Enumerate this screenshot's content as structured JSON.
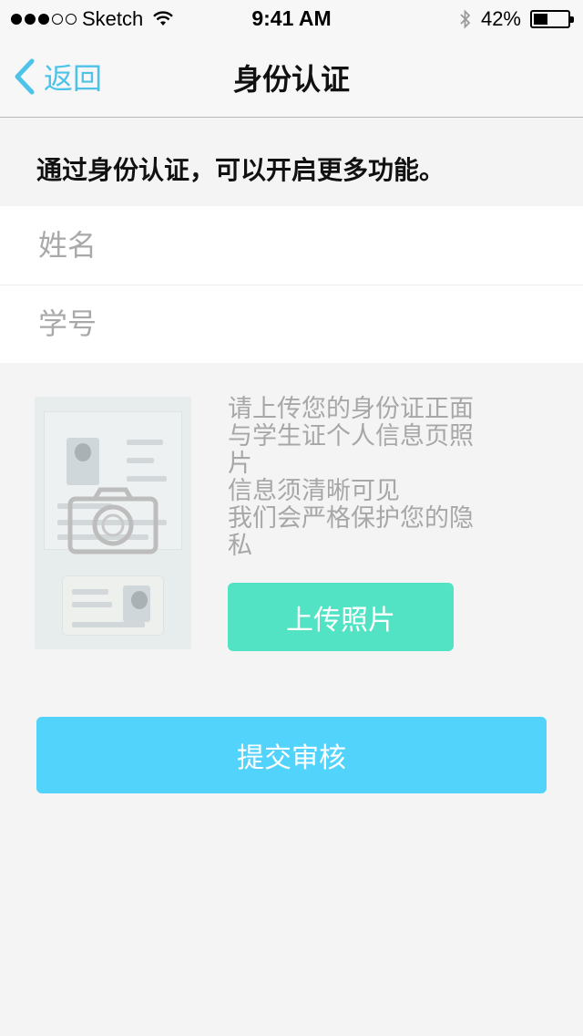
{
  "status_bar": {
    "carrier": "Sketch",
    "time": "9:41 AM",
    "battery_percent": "42%",
    "battery_level": 0.42,
    "signal_icon": "signal-dots-icon",
    "wifi_icon": "wifi-icon",
    "bluetooth_icon": "bluetooth-icon",
    "battery_icon": "battery-icon"
  },
  "nav": {
    "back_label": "返回",
    "back_icon": "chevron-left-icon",
    "title": "身份认证",
    "accent": "#4ec3ea"
  },
  "intro": "通过身份认证，可以开启更多功能。",
  "form": {
    "name_placeholder": "姓名",
    "student_id_placeholder": "学号"
  },
  "photo": {
    "camera_icon": "camera-icon",
    "hint_lines": [
      "请上传您的身份证正面",
      "与学生证个人信息页照",
      "片",
      "信息须清晰可见",
      "我们会严格保护您的隐",
      "私"
    ],
    "upload_label": "上传照片",
    "upload_color": "#52e3c4"
  },
  "submit_label": "提交审核",
  "submit_color": "#52d3fc"
}
